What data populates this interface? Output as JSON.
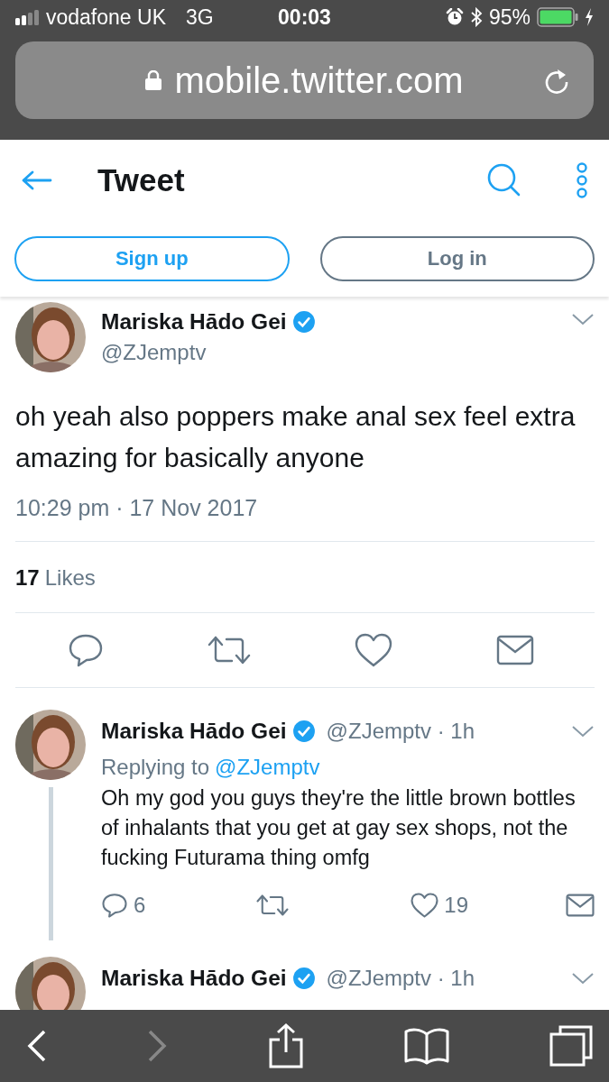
{
  "status_bar": {
    "carrier": "vodafone UK",
    "network": "3G",
    "time": "00:03",
    "battery": "95%"
  },
  "browser": {
    "url": "mobile.twitter.com"
  },
  "header": {
    "title": "Tweet"
  },
  "auth_buttons": [
    {
      "label": "Sign up",
      "kind": "primary"
    },
    {
      "label": "Log in",
      "kind": "secondary"
    }
  ],
  "main_tweet": {
    "name": "Mariska Hādo Gei",
    "verified": true,
    "handle": "@ZJemptv",
    "text": "oh yeah also poppers make anal sex feel extra amazing for basically anyone",
    "timestamp": "10:29 pm · 17 Nov 2017",
    "likes_count": "17",
    "likes_label": "Likes"
  },
  "replies": [
    {
      "name": "Mariska Hādo Gei",
      "verified": true,
      "handle": "@ZJemptv · 1h",
      "replying_label": "Replying to",
      "replying_to": "@ZJemptv",
      "text": "Oh my god you guys they're the little brown bottles of inhalants that you get at gay sex shops, not the fucking Futurama thing omfg",
      "thread_continues": true,
      "actions": [
        {
          "kind": "reply",
          "count": "6"
        },
        {
          "kind": "retweet"
        },
        {
          "kind": "like",
          "count": "19"
        },
        {
          "kind": "message"
        }
      ]
    },
    {
      "name": "Mariska Hādo Gei",
      "verified": true,
      "handle": "@ZJemptv · 1h",
      "thread_continues": false
    }
  ],
  "browser_toolbar": [
    {
      "kind": "back",
      "disabled": false
    },
    {
      "kind": "forward",
      "disabled": true
    },
    {
      "kind": "share",
      "disabled": false
    },
    {
      "kind": "bookmarks",
      "disabled": false
    },
    {
      "kind": "tabs",
      "disabled": false
    }
  ]
}
